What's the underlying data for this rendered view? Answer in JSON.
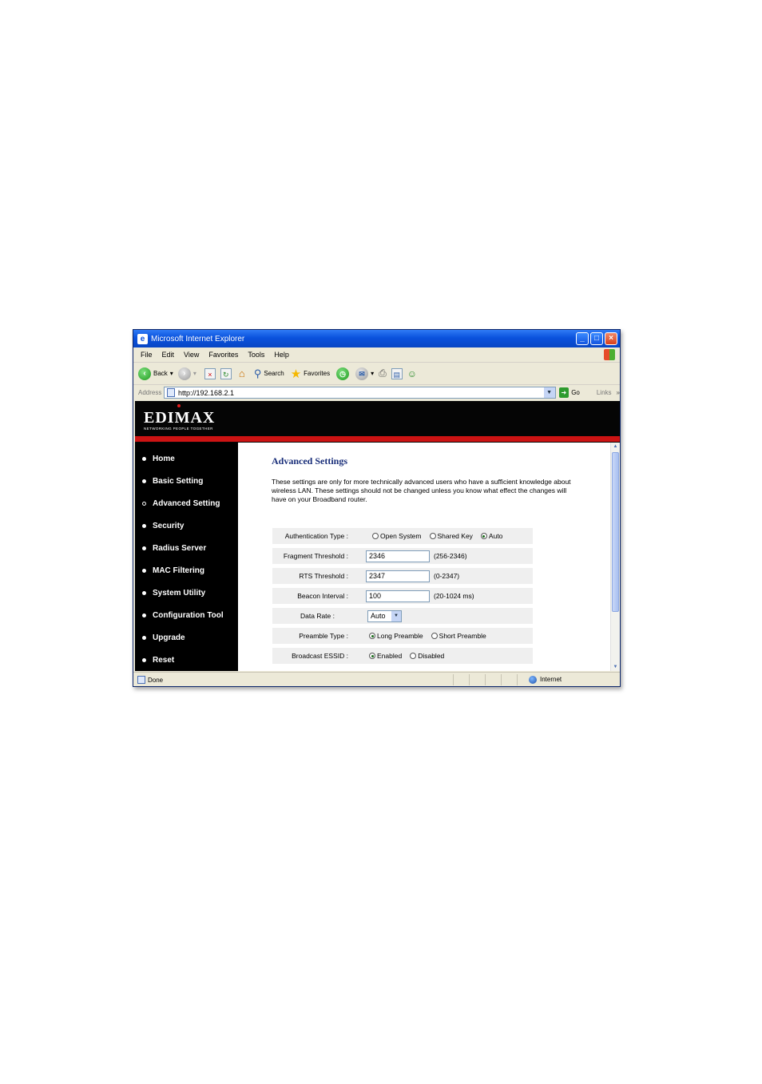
{
  "window": {
    "title": "Microsoft Internet Explorer"
  },
  "menu": [
    "File",
    "Edit",
    "View",
    "Favorites",
    "Tools",
    "Help"
  ],
  "toolbar": {
    "back_label": "Back",
    "search_label": "Search",
    "favorites_label": "Favorites"
  },
  "address": {
    "label": "Address",
    "url": "http://192.168.2.1",
    "go_label": "Go",
    "links_label": "Links"
  },
  "brand": {
    "logo": "EDIMAX",
    "tagline": "NETWORKING PEOPLE TOGETHER"
  },
  "nav": [
    {
      "label": "Home"
    },
    {
      "label": "Basic Setting"
    },
    {
      "label": "Advanced Setting"
    },
    {
      "label": "Security"
    },
    {
      "label": "Radius Server"
    },
    {
      "label": "MAC Filtering"
    },
    {
      "label": "System Utility"
    },
    {
      "label": "Configuration Tool"
    },
    {
      "label": "Upgrade"
    },
    {
      "label": "Reset"
    }
  ],
  "main": {
    "title": "Advanced Settings",
    "description": "These settings are only for more technically advanced users who have a sufficient knowledge about wireless LAN. These settings should not be changed unless you know what effect the changes will have on your Broadband router.",
    "settings": {
      "auth_type": {
        "label": "Authentication Type :",
        "options": [
          "Open System",
          "Shared Key",
          "Auto"
        ],
        "selected": "Auto"
      },
      "fragment": {
        "label": "Fragment Threshold :",
        "value": "2346",
        "range": "(256-2346)"
      },
      "rts": {
        "label": "RTS Threshold :",
        "value": "2347",
        "range": "(0-2347)"
      },
      "beacon": {
        "label": "Beacon Interval :",
        "value": "100",
        "range": "(20-1024 ms)"
      },
      "data_rate": {
        "label": "Data Rate :",
        "value": "Auto"
      },
      "preamble": {
        "label": "Preamble Type :",
        "options": [
          "Long Preamble",
          "Short Preamble"
        ],
        "selected": "Long Preamble"
      },
      "broadcast_essid": {
        "label": "Broadcast ESSID :",
        "options": [
          "Enabled",
          "Disabled"
        ],
        "selected": "Enabled"
      }
    }
  },
  "status": {
    "text": "Done",
    "zone": "Internet"
  }
}
